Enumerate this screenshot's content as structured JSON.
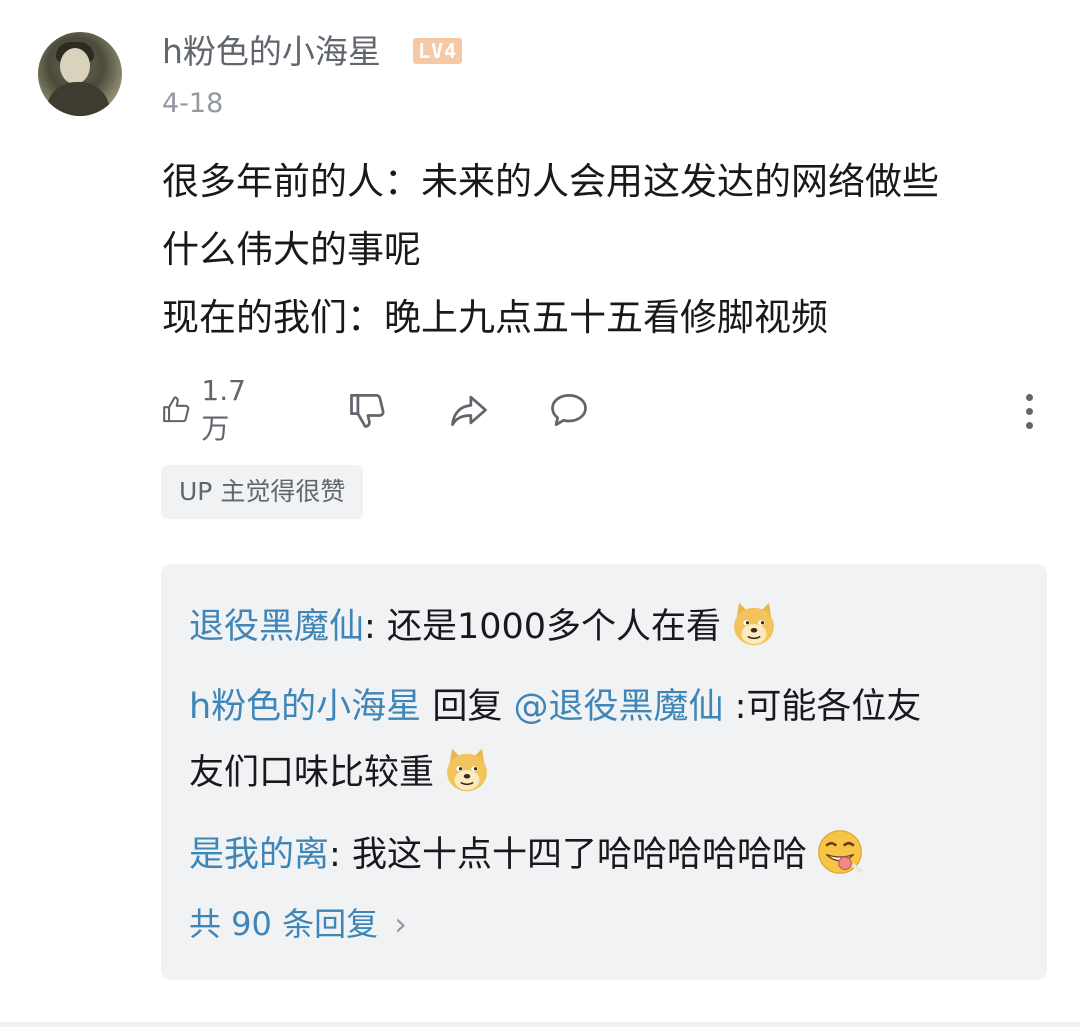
{
  "comment": {
    "username": "h粉色的小海星",
    "level_badge": "LV4",
    "date": "4-18",
    "content_lines": [
      "很多年前的人：未来的人会用这发达的网络做些",
      "什么伟大的事呢",
      "现在的我们：晚上九点五十五看修脚视频"
    ],
    "likes": "1.7万",
    "up_badge": "UP 主觉得很赞"
  },
  "replies": {
    "items": [
      {
        "user": "退役黑魔仙",
        "separator": ": ",
        "text": "还是1000多个人在看",
        "emoji": "doge-emoji"
      },
      {
        "user": "h粉色的小海星",
        "reply_word": " 回复 ",
        "mention": "@退役黑魔仙",
        "text_line1": " :可能各位友",
        "text_line2": "友们口味比较重",
        "emoji": "doge-emoji"
      },
      {
        "user": "是我的离",
        "separator": ": ",
        "text": "我这十点十四了哈哈哈哈哈哈",
        "emoji": "grin-tongue-emoji"
      }
    ],
    "more_label": "共 90 条回复",
    "more_chevron": "›"
  },
  "icons": [
    "thumbs-up-icon",
    "thumbs-down-icon",
    "share-icon",
    "comment-icon",
    "more-vertical-icon"
  ],
  "colors": {
    "link_blue": "#3f86b8",
    "text_gray": "#61666d",
    "panel_bg": "#f1f2f3",
    "level_bg": "#f6c9a6"
  }
}
